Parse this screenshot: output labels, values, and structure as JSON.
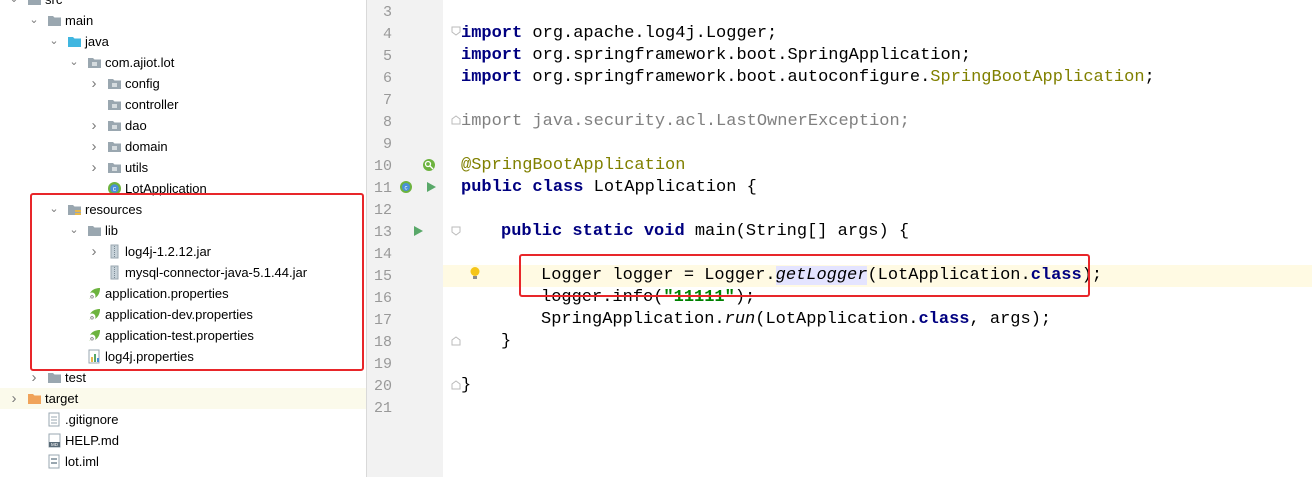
{
  "project_tree": {
    "items": [
      {
        "label": "src",
        "icon": "folder-icon",
        "indent": 0,
        "expanded": true
      },
      {
        "label": "main",
        "icon": "folder-icon",
        "indent": 1,
        "expanded": true
      },
      {
        "label": "java",
        "icon": "source-folder-icon",
        "indent": 2,
        "expanded": true
      },
      {
        "label": "com.ajiot.lot",
        "icon": "package-icon",
        "indent": 3,
        "expanded": true
      },
      {
        "label": "config",
        "icon": "package-icon",
        "indent": 4,
        "expanded": false
      },
      {
        "label": "controller",
        "icon": "package-icon",
        "indent": 4,
        "expanded": null
      },
      {
        "label": "dao",
        "icon": "package-icon",
        "indent": 4,
        "expanded": false
      },
      {
        "label": "domain",
        "icon": "package-icon",
        "indent": 4,
        "expanded": false
      },
      {
        "label": "utils",
        "icon": "package-icon",
        "indent": 4,
        "expanded": false
      },
      {
        "label": "LotApplication",
        "icon": "spring-class-icon",
        "indent": 4,
        "expanded": null
      },
      {
        "label": "resources",
        "icon": "resources-folder-icon",
        "indent": 2,
        "expanded": true
      },
      {
        "label": "lib",
        "icon": "folder-icon",
        "indent": 3,
        "expanded": true
      },
      {
        "label": "log4j-1.2.12.jar",
        "icon": "jar-icon",
        "indent": 4,
        "expanded": false
      },
      {
        "label": "mysql-connector-java-5.1.44.jar",
        "icon": "jar-icon",
        "indent": 4,
        "expanded": null
      },
      {
        "label": "application.properties",
        "icon": "spring-properties-icon",
        "indent": 3,
        "expanded": null
      },
      {
        "label": "application-dev.properties",
        "icon": "spring-properties-icon",
        "indent": 3,
        "expanded": null
      },
      {
        "label": "application-test.properties",
        "icon": "spring-properties-icon",
        "indent": 3,
        "expanded": null
      },
      {
        "label": "log4j.properties",
        "icon": "properties-file-icon",
        "indent": 3,
        "expanded": null
      },
      {
        "label": "test",
        "icon": "folder-icon",
        "indent": 1,
        "expanded": false
      },
      {
        "label": "target",
        "icon": "excluded-folder-icon",
        "indent": 0,
        "expanded": false
      },
      {
        "label": ".gitignore",
        "icon": "text-file-icon",
        "indent": 1,
        "expanded": null
      },
      {
        "label": "HELP.md",
        "icon": "markdown-file-icon",
        "indent": 1,
        "expanded": null
      },
      {
        "label": "lot.iml",
        "icon": "iml-file-icon",
        "indent": 1,
        "expanded": null
      }
    ]
  },
  "editor": {
    "line_numbers": [
      "3",
      "4",
      "5",
      "6",
      "7",
      "8",
      "9",
      "10",
      "11",
      "12",
      "13",
      "14",
      "15",
      "16",
      "17",
      "18",
      "19",
      "20",
      "21"
    ],
    "lines": {
      "l4": {
        "kw": "import",
        "rest": " org.apache.log4j.Logger;"
      },
      "l5": {
        "kw": "import",
        "rest": " org.springframework.boot.SpringApplication;"
      },
      "l6": {
        "kw": "import",
        "rest": " org.springframework.boot.autoconfigure.",
        "ann": "SpringBootApplication",
        "end": ";"
      },
      "l8": {
        "kw": "import",
        "rest": " java.security.acl.LastOwnerException;"
      },
      "l10": {
        "ann": "@SpringBootApplication"
      },
      "l11": {
        "kw1": "public",
        "kw2": "class",
        "rest": " LotApplication {"
      },
      "l13": {
        "kw1": "public",
        "kw2": "static",
        "kw3": "void",
        "rest": " main(String[] args) {"
      },
      "l15": {
        "a": "Logger logger = Logger.",
        "method": "getLogger",
        "b": "(LotApplication.",
        "kw": "class",
        "c": ");"
      },
      "l16": {
        "a": "logger.info(",
        "str": "\"11111\"",
        "b": ");"
      },
      "l17": {
        "a": "SpringApplication.",
        "method": "run",
        "b": "(LotApplication.",
        "kw": "class",
        "c": ", args);"
      },
      "l18": {
        "a": "}"
      },
      "l20": {
        "a": "}"
      }
    },
    "current_line": "15"
  },
  "colors": {
    "highlight_box": "#e8262a",
    "keyword": "#000080",
    "annotation": "#808000",
    "string": "#008000"
  }
}
